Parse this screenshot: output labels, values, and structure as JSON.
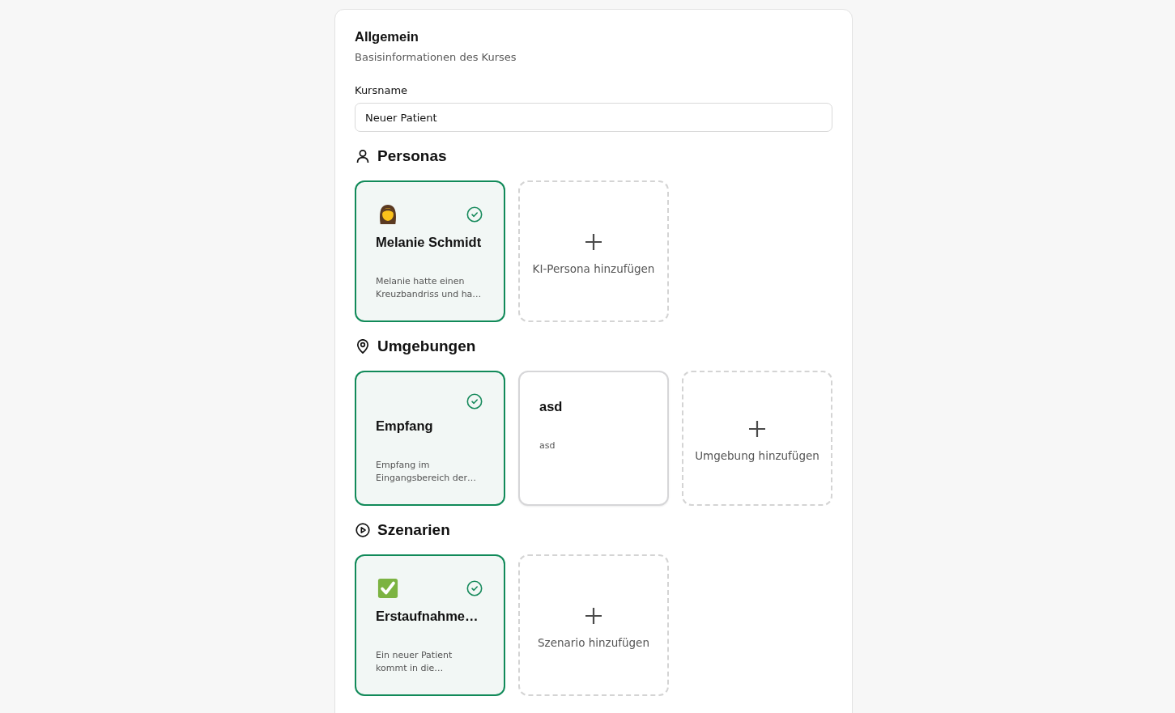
{
  "section": {
    "title": "Allgemein",
    "subtitle": "Basisinformationen des Kurses"
  },
  "course_name": {
    "label": "Kursname",
    "value": "Neuer Patient"
  },
  "groups": [
    {
      "title": "Personas",
      "items": [
        {
          "kind": "avatar",
          "title": "Melanie Schmidt",
          "description": "Melanie hatte einen Kreuzbandriss und ha…",
          "selected": true
        }
      ],
      "add_button": "KI-Persona hinzufügen"
    },
    {
      "title": "Umgebungen",
      "items": [
        {
          "kind": "plain",
          "title": "Empfang",
          "description": "Empfang im Eingangsbereich der…",
          "selected": true
        },
        {
          "kind": "plain",
          "title": "asd",
          "description": "asd",
          "selected": false
        }
      ],
      "add_button": "Umgebung hinzufügen"
    },
    {
      "title": "Szenarien",
      "items": [
        {
          "kind": "tick",
          "title": "Erstaufnahme…",
          "description": "Ein neuer Patient kommt in die…",
          "selected": true
        }
      ],
      "add_button": "Szenario hinzufügen"
    }
  ]
}
